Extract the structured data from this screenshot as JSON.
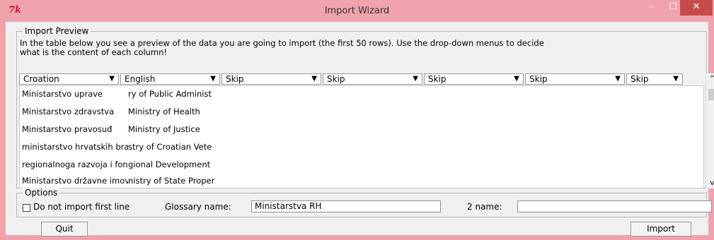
{
  "window": {
    "title": "Import Wizard",
    "app_icon_text": "7k",
    "minimize": "–",
    "maximize": "☐",
    "close": "✕"
  },
  "preview": {
    "legend": "Import Preview",
    "description": "In the table below you see a preview of the data you are going to import (the first 50 rows). Use the drop-down menus to decide what is the content of each column!",
    "columns": [
      "Croation",
      "English",
      "Skip",
      "Skip",
      "Skip",
      "Skip",
      "Skip"
    ],
    "rows": [
      [
        "Ministarstvo uprave",
        "ry of Public Administ"
      ],
      [
        "Ministarstvo zdravstva",
        "Ministry of Health"
      ],
      [
        "Ministarstvo pravosuđ",
        "Ministry of Justice"
      ],
      [
        "ministarstvo hrvatskih branitelja",
        "stry of Croatian Vete"
      ],
      [
        "regionalnoga razvoja i fonda",
        "gional Development"
      ],
      [
        "Ministarstvo državne imovine",
        "nistry of State Proper"
      ]
    ]
  },
  "options": {
    "legend": "Options",
    "checkbox_label": "Do not import first line",
    "glossary_label": "Glossary name:",
    "glossary_value": "Ministarstva RH",
    "name2_label": "2 name:",
    "name2_value": ""
  },
  "buttons": {
    "quit": "Quit",
    "import": "Import"
  },
  "colors": {
    "titlebar": "#f0a3ad",
    "close": "#c84b4b",
    "panel": "#f0f0f0"
  }
}
